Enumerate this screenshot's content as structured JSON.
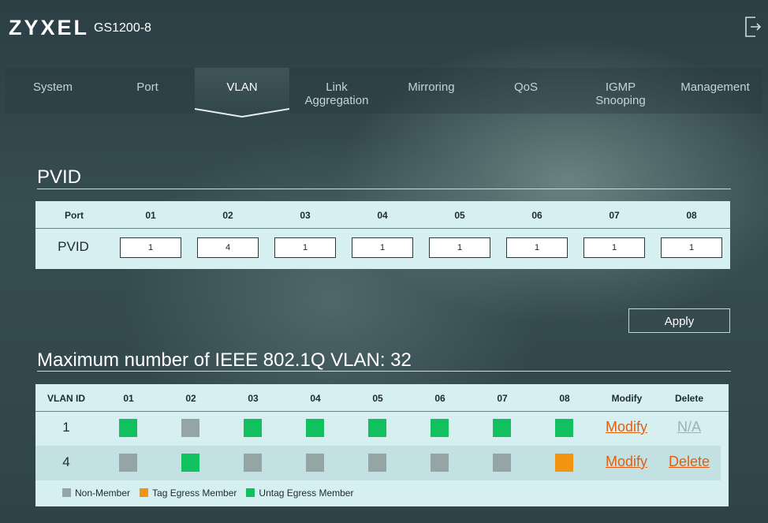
{
  "header": {
    "brand": "ZYXEL",
    "model": "GS1200-8",
    "logout_icon": "logout-icon"
  },
  "nav": {
    "tabs": [
      {
        "label": "System",
        "active": false
      },
      {
        "label": "Port",
        "active": false
      },
      {
        "label": "VLAN",
        "active": true
      },
      {
        "label": "Link Aggregation",
        "active": false
      },
      {
        "label": "Mirroring",
        "active": false
      },
      {
        "label": "QoS",
        "active": false
      },
      {
        "label": "IGMP Snooping",
        "active": false
      },
      {
        "label": "Management",
        "active": false
      }
    ]
  },
  "pvid": {
    "title": "PVID",
    "header_label": "Port",
    "row_label": "PVID",
    "ports": [
      "01",
      "02",
      "03",
      "04",
      "05",
      "06",
      "07",
      "08"
    ],
    "values": [
      "1",
      "4",
      "1",
      "1",
      "1",
      "1",
      "1",
      "1"
    ]
  },
  "apply_label": "Apply",
  "vlan": {
    "title": "Maximum number of IEEE 802.1Q VLAN: 32",
    "headers": [
      "VLAN ID",
      "01",
      "02",
      "03",
      "04",
      "05",
      "06",
      "07",
      "08",
      "Modify",
      "Delete"
    ],
    "rows": [
      {
        "id": "1",
        "ports": [
          "untag",
          "none",
          "untag",
          "untag",
          "untag",
          "untag",
          "untag",
          "untag"
        ],
        "modify": "Modify",
        "delete": "N/A",
        "delete_enabled": false
      },
      {
        "id": "4",
        "ports": [
          "none",
          "untag",
          "none",
          "none",
          "none",
          "none",
          "none",
          "tag"
        ],
        "modify": "Modify",
        "delete": "Delete",
        "delete_enabled": true
      }
    ],
    "legend": [
      {
        "key": "none",
        "label": "Non-Member"
      },
      {
        "key": "tag",
        "label": "Tag Egress Member"
      },
      {
        "key": "untag",
        "label": "Untag Egress Member"
      }
    ]
  },
  "colors": {
    "none": "#95a5a6",
    "tag": "#f2940f",
    "untag": "#11c05e",
    "link": "#e06010",
    "disabled_link": "#9fb0b2"
  }
}
